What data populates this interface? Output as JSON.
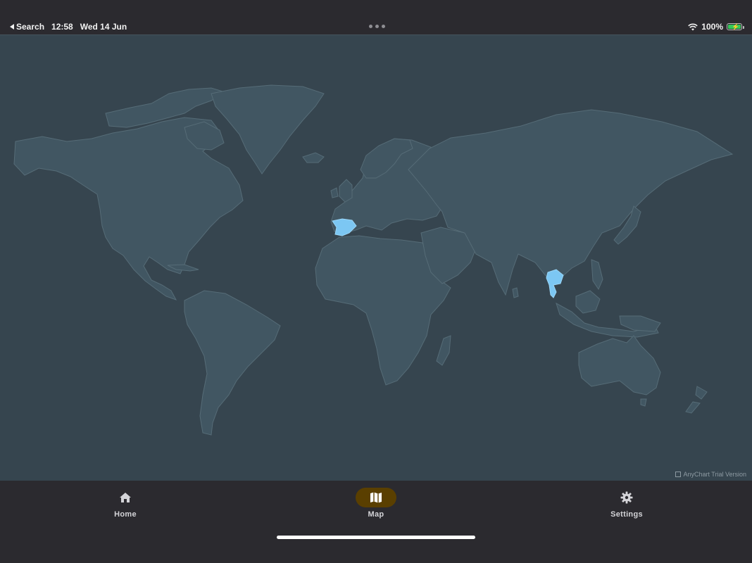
{
  "status_bar": {
    "back_label": "Search",
    "time": "12:58",
    "date": "Wed 14 Jun",
    "battery_percent": "100%",
    "battery_level": 1.0,
    "charging": true
  },
  "map": {
    "highlighted_regions": [
      "Spain",
      "Thailand"
    ],
    "colors": {
      "background": "#36454f",
      "land": "#415662",
      "borders": "#566c77",
      "highlight": "#7cc7f3"
    },
    "credit": "AnyChart Trial Version"
  },
  "tab_bar": {
    "active_tab": "Map",
    "accent_color": "#5a3f00",
    "tabs": [
      {
        "label": "Home",
        "icon": "house-icon"
      },
      {
        "label": "Map",
        "icon": "map-icon"
      },
      {
        "label": "Settings",
        "icon": "gear-icon"
      }
    ]
  }
}
